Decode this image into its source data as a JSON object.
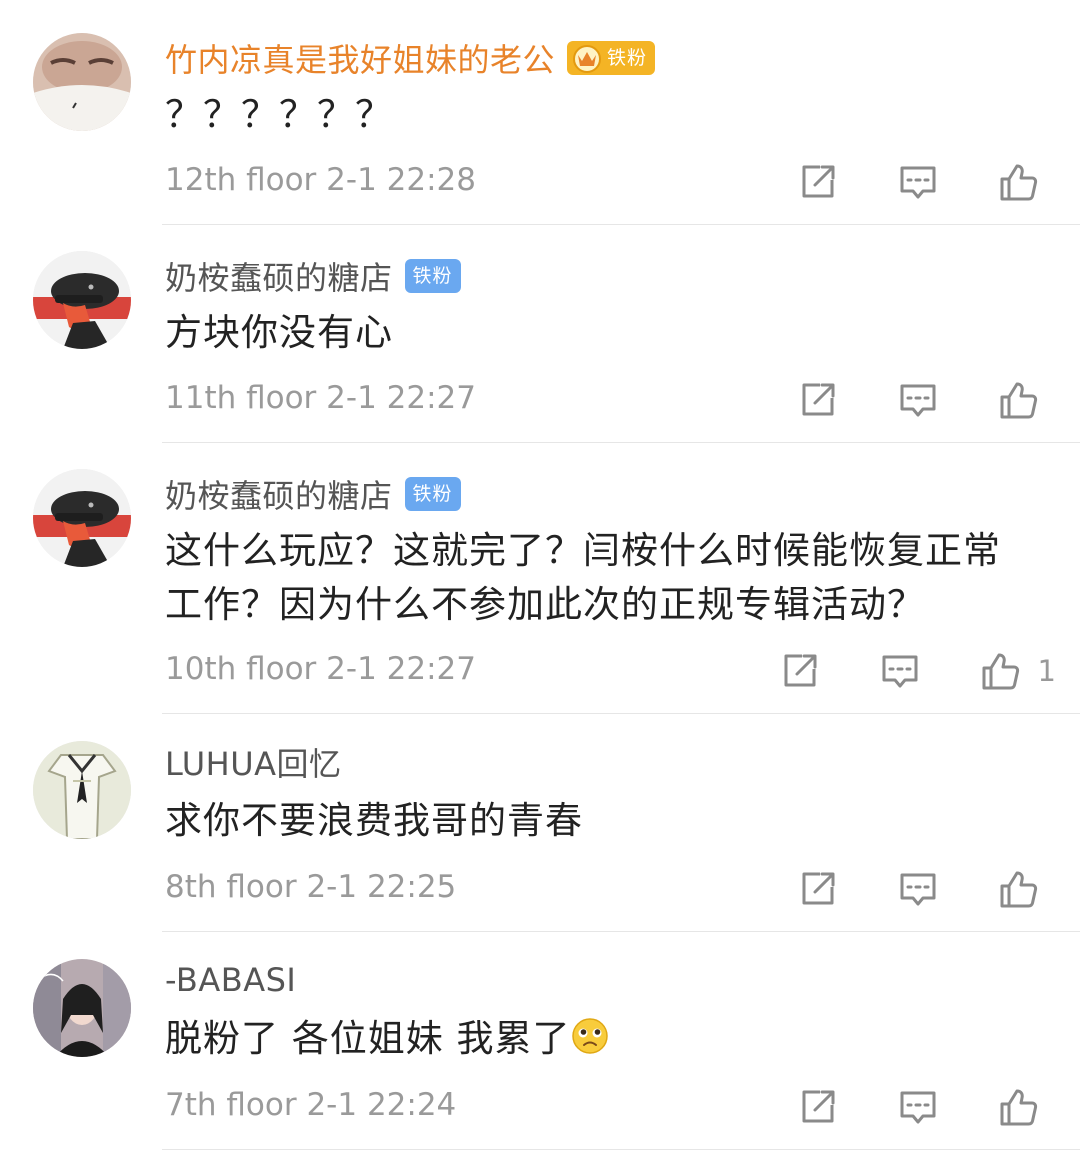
{
  "comments": [
    {
      "username": "竹内凉真是我好姐妹的老公",
      "badge": "铁粉",
      "badge_color": "#f4b425",
      "name_color": "#e8832a",
      "avatar_icon": "masked-face-avatar",
      "text": "？？？？？？",
      "floor": "12th floor",
      "time": "2-1 22:28",
      "like_count": ""
    },
    {
      "username": "奶桉蠢硕的糖店",
      "badge": "铁粉",
      "badge_color": "#6aa8f0",
      "avatar_icon": "cap-person-avatar",
      "text": "方块你没有心",
      "floor": "11th floor",
      "time": "2-1 22:27",
      "like_count": ""
    },
    {
      "username": "奶桉蠢硕的糖店",
      "badge": "铁粉",
      "badge_color": "#6aa8f0",
      "avatar_icon": "cap-person-avatar",
      "text_line1": "这什么玩应？这就完了？闫桉什么时候能恢复正常",
      "text_line2": "工作？因为什么不参加此次的正规专辑活动？",
      "floor": "10th floor",
      "time": "2-1 22:27",
      "like_count": "1"
    },
    {
      "username": "LUHUA回忆",
      "avatar_icon": "sailor-dress-avatar",
      "text": "求你不要浪费我哥的青春",
      "floor": "8th floor",
      "time": "2-1 22:25",
      "like_count": ""
    },
    {
      "username": "-BABASI",
      "avatar_icon": "girl-portrait-avatar",
      "text": "脱粉了 各位姐妹 我累了",
      "emoji": "sad-face-emoji",
      "floor": "7th floor",
      "time": "2-1 22:24",
      "like_count": ""
    }
  ]
}
